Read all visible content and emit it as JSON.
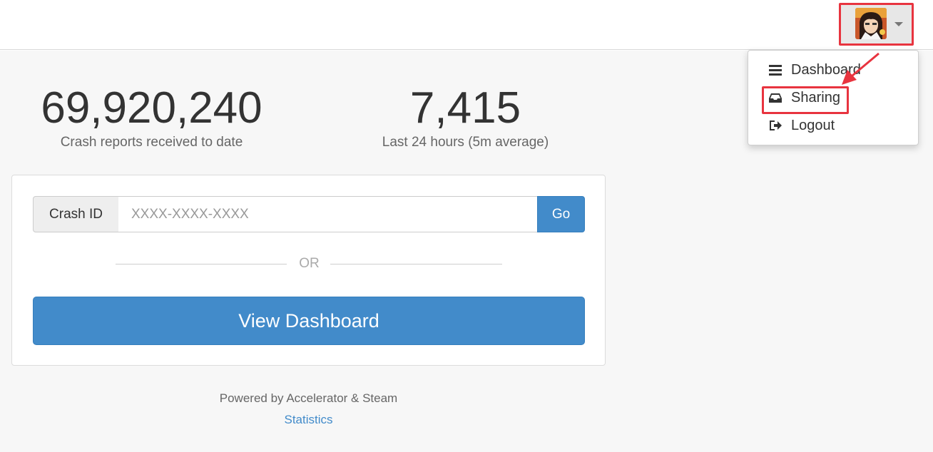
{
  "header": {
    "user_menu": {
      "avatar_icon": "user-avatar",
      "caret_icon": "caret-down-icon"
    }
  },
  "stats": [
    {
      "value": "69,920,240",
      "label": "Crash reports received to date"
    },
    {
      "value": "7,415",
      "label": "Last 24 hours (5m average)"
    }
  ],
  "search": {
    "addon_label": "Crash ID",
    "placeholder": "XXXX-XXXX-XXXX",
    "value": "",
    "go_label": "Go"
  },
  "divider_text": "OR",
  "dashboard_button_label": "View Dashboard",
  "footer": {
    "powered_text": "Powered by Accelerator & Steam",
    "statistics_link": "Statistics"
  },
  "dropdown": {
    "items": [
      {
        "label": "Dashboard",
        "icon": "list-icon"
      },
      {
        "label": "Sharing",
        "icon": "inbox-icon"
      },
      {
        "label": "Logout",
        "icon": "sign-out-icon"
      }
    ]
  },
  "colors": {
    "primary": "#428bca",
    "annotation": "#e8343f",
    "background": "#f7f7f7"
  }
}
